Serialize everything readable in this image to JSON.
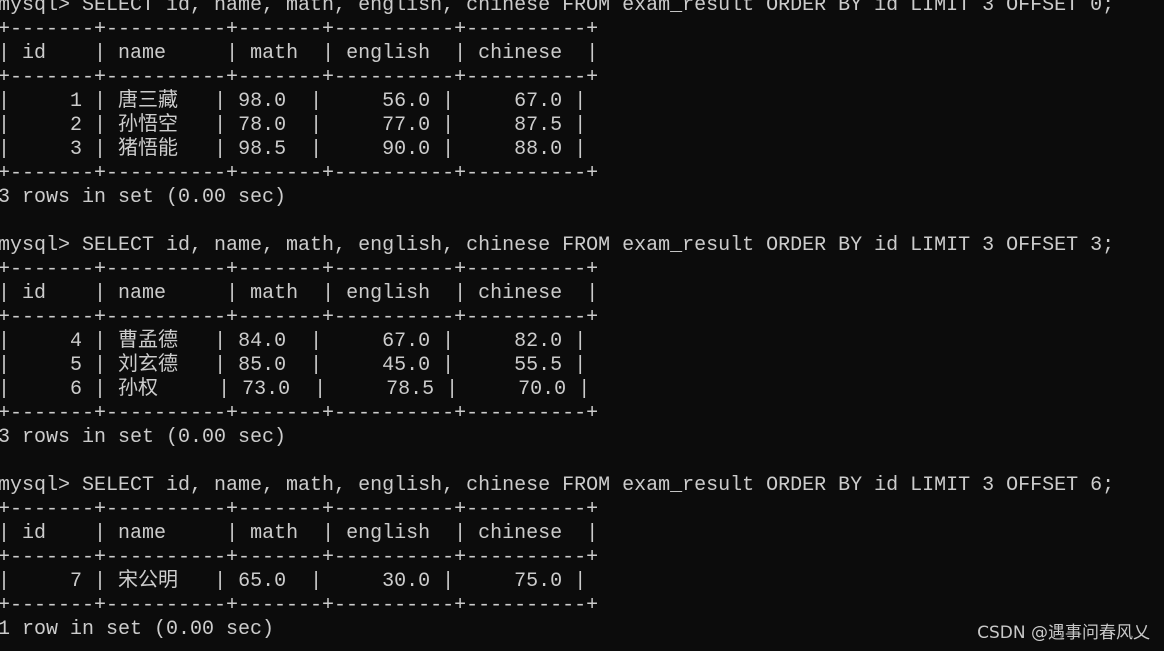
{
  "terminal": {
    "prompt": "mysql>",
    "columns": [
      "id",
      "name",
      "math",
      "english",
      "chinese"
    ],
    "queries": [
      {
        "command": "SELECT id, name, math, english, chinese FROM exam_result ORDER BY id LIMIT 3 OFFSET 0;",
        "rows": [
          {
            "id": "1",
            "name": "唐三藏",
            "math": "98.0",
            "english": "56.0",
            "chinese": "67.0"
          },
          {
            "id": "2",
            "name": "孙悟空",
            "math": "78.0",
            "english": "77.0",
            "chinese": "87.5"
          },
          {
            "id": "3",
            "name": "猪悟能",
            "math": "98.5",
            "english": "90.0",
            "chinese": "88.0"
          }
        ],
        "status": "3 rows in set (0.00 sec)"
      },
      {
        "command": "SELECT id, name, math, english, chinese FROM exam_result ORDER BY id LIMIT 3 OFFSET 3;",
        "rows": [
          {
            "id": "4",
            "name": "曹孟德",
            "math": "84.0",
            "english": "67.0",
            "chinese": "82.0"
          },
          {
            "id": "5",
            "name": "刘玄德",
            "math": "85.0",
            "english": "45.0",
            "chinese": "55.5"
          },
          {
            "id": "6",
            "name": "孙权",
            "math": "73.0",
            "english": "78.5",
            "chinese": "70.0"
          }
        ],
        "status": "3 rows in set (0.00 sec)"
      },
      {
        "command": "SELECT id, name, math, english, chinese FROM exam_result ORDER BY id LIMIT 3 OFFSET 6;",
        "rows": [
          {
            "id": "7",
            "name": "宋公明",
            "math": "65.0",
            "english": "30.0",
            "chinese": "75.0"
          }
        ],
        "status": "1 row in set (0.00 sec)"
      }
    ]
  },
  "watermark": "CSDN @遇事问春风乂"
}
